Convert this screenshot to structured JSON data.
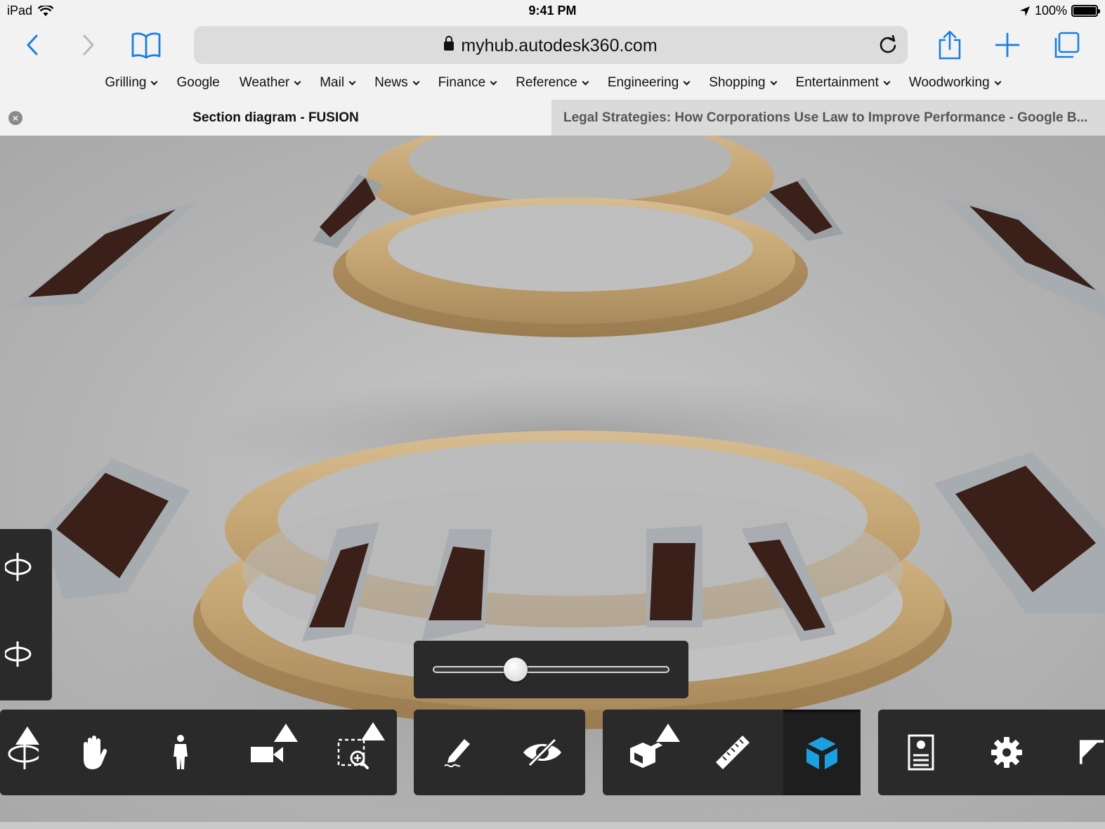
{
  "status_bar": {
    "device": "iPad",
    "time": "9:41 PM",
    "battery": "100%",
    "icons": [
      "wifi-icon",
      "location-arrow-icon",
      "battery-icon"
    ]
  },
  "toolbar": {
    "url": "myhub.autodesk360.com",
    "icons": [
      "back-icon",
      "forward-icon",
      "bookmarks-book-icon",
      "lock-icon",
      "reload-icon",
      "share-icon",
      "new-tab-plus-icon",
      "tabs-icon"
    ]
  },
  "bookmarks": [
    {
      "label": "Grilling",
      "dropdown": true
    },
    {
      "label": "Google",
      "dropdown": false
    },
    {
      "label": "Weather",
      "dropdown": true
    },
    {
      "label": "Mail",
      "dropdown": true
    },
    {
      "label": "News",
      "dropdown": true
    },
    {
      "label": "Finance",
      "dropdown": true
    },
    {
      "label": "Reference",
      "dropdown": true
    },
    {
      "label": "Engineering",
      "dropdown": true
    },
    {
      "label": "Shopping",
      "dropdown": true
    },
    {
      "label": "Entertainment",
      "dropdown": true
    },
    {
      "label": "Woodworking",
      "dropdown": true
    }
  ],
  "tabs": [
    {
      "title": "Section diagram - FUSION",
      "active": true
    },
    {
      "title": "Legal Strategies: How Corporations Use Law to Improve Performance - Google B...",
      "active": false
    }
  ],
  "viewer": {
    "slider_value": 0.35,
    "side_tools": [
      "orbit-icon",
      "free-orbit-icon"
    ],
    "tool_groups": [
      {
        "tools": [
          "orbit-tool-icon",
          "pan-hand-icon",
          "walk-person-icon",
          "camera-icon",
          "zoom-window-icon"
        ]
      },
      {
        "tools": [
          "markup-pencil-icon",
          "hide-eye-icon"
        ]
      },
      {
        "tools": [
          "explode-model-icon",
          "measure-ruler-icon",
          "section-cube-icon"
        ],
        "selected": "section-cube-icon"
      },
      {
        "tools": [
          "model-browser-icon",
          "settings-gear-icon",
          "fullscreen-icon"
        ]
      }
    ],
    "accent_color": "#1a9fe0"
  }
}
